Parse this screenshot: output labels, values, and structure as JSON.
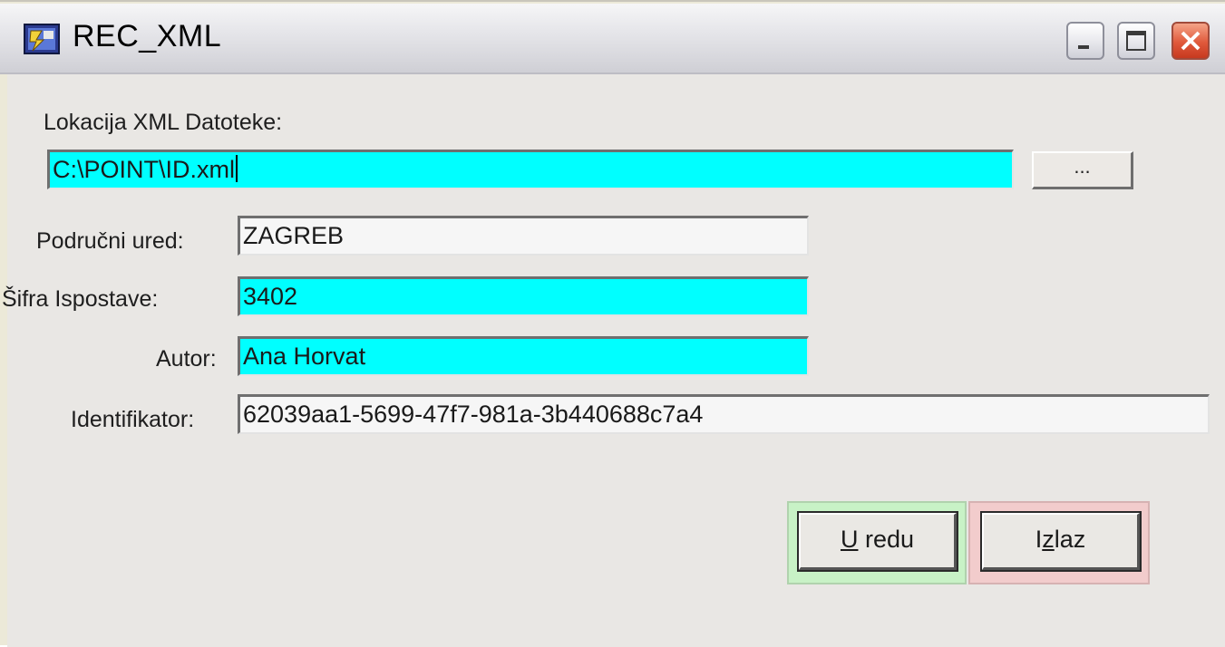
{
  "window": {
    "title": "REC_XML",
    "buttons": {
      "minimize": "minimize-icon",
      "maximize": "maximize-icon",
      "close": "close-icon"
    }
  },
  "form": {
    "xml_location": {
      "label": "Lokacija XML Datoteke:",
      "value": "C:\\POINT\\ID.xml",
      "browse_label": "..."
    },
    "regional_office": {
      "label": "Područni ured:",
      "value": "ZAGREB"
    },
    "branch_code": {
      "label": "Šifra Ispostave:",
      "value": "3402"
    },
    "author": {
      "label": "Autor:",
      "value": "Ana Horvat"
    },
    "identifier": {
      "label": "Identifikator:",
      "value": "62039aa1-5699-47f7-981a-3b440688c7a4"
    }
  },
  "actions": {
    "ok": {
      "mnemonic": "U",
      "rest": " redu"
    },
    "exit": {
      "mnemonic": "z",
      "prefix": "I",
      "rest": "laz"
    }
  },
  "colors": {
    "required_field": "#00FFFF",
    "optional_field": "#F6F6F6",
    "ok_frame": "#C8F2C6",
    "exit_frame": "#F2CCCC",
    "dialog_bg": "#E9E7E4"
  }
}
